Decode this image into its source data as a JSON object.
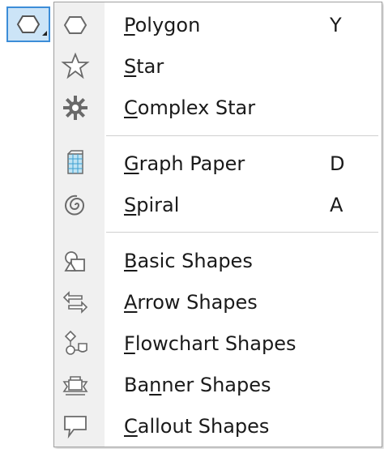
{
  "colors": {
    "tool_button_bg": "#cce4f7",
    "tool_button_border": "#3c8dd8",
    "menu_bg": "#ffffff",
    "gutter_bg": "#f0f0f0",
    "separator": "#d0d0d0",
    "text": "#1a1a1a",
    "icon_stroke": "#6a6a6a"
  },
  "toolbar": {
    "polygon_tool_icon": "polygon-tool-icon",
    "flyout_indicator_icon": "flyout-triangle-icon"
  },
  "menu": {
    "groups": [
      [
        {
          "icon": "polygon-icon",
          "label": "Polygon",
          "mnemonic_index": 0,
          "shortcut": "Y"
        },
        {
          "icon": "star-icon",
          "label": "Star",
          "mnemonic_index": 0,
          "shortcut": ""
        },
        {
          "icon": "complex-star-icon",
          "label": "Complex Star",
          "mnemonic_index": 0,
          "shortcut": ""
        }
      ],
      [
        {
          "icon": "graph-paper-icon",
          "label": "Graph Paper",
          "mnemonic_index": 0,
          "shortcut": "D"
        },
        {
          "icon": "spiral-icon",
          "label": "Spiral",
          "mnemonic_index": 0,
          "shortcut": "A"
        }
      ],
      [
        {
          "icon": "basic-shapes-icon",
          "label": "Basic Shapes",
          "mnemonic_index": 0,
          "shortcut": ""
        },
        {
          "icon": "arrow-shapes-icon",
          "label": "Arrow Shapes",
          "mnemonic_index": 0,
          "shortcut": ""
        },
        {
          "icon": "flowchart-shapes-icon",
          "label": "Flowchart Shapes",
          "mnemonic_index": 0,
          "shortcut": ""
        },
        {
          "icon": "banner-shapes-icon",
          "label": "Banner Shapes",
          "mnemonic_index": 2,
          "shortcut": ""
        },
        {
          "icon": "callout-shapes-icon",
          "label": "Callout Shapes",
          "mnemonic_index": 0,
          "shortcut": ""
        }
      ]
    ]
  }
}
